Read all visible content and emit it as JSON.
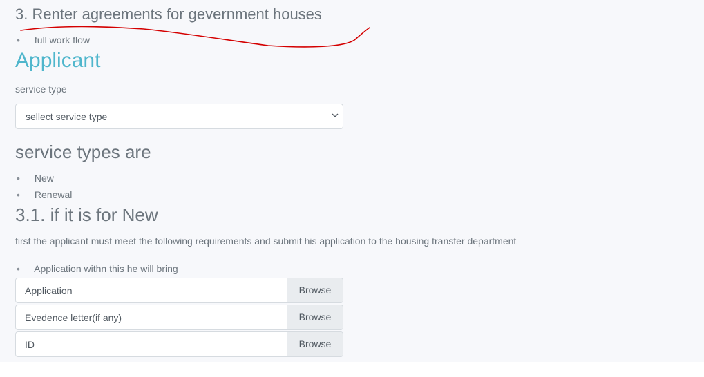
{
  "section": {
    "title": "3. Renter agreements for gevernment houses",
    "bullet": "full work flow"
  },
  "applicant": {
    "heading": "Applicant",
    "service_label": "service type",
    "select_value": "sellect service type"
  },
  "service_types": {
    "heading": "service types are",
    "items": [
      "New",
      "Renewal"
    ]
  },
  "new_section": {
    "heading": "3.1. if it is for New",
    "paragraph": "first the applicant must meet the following requirements and submit his application to the housing transfer department",
    "bullet": "Application withn this he will bring"
  },
  "files": [
    {
      "name": "Application",
      "button": "Browse"
    },
    {
      "name": "Evedence letter(if any)",
      "button": "Browse"
    },
    {
      "name": "ID",
      "button": "Browse"
    }
  ],
  "colors": {
    "accent": "#4fb6cc",
    "annotation": "#d40000"
  },
  "icons": {
    "select": "chevron-down-icon"
  }
}
